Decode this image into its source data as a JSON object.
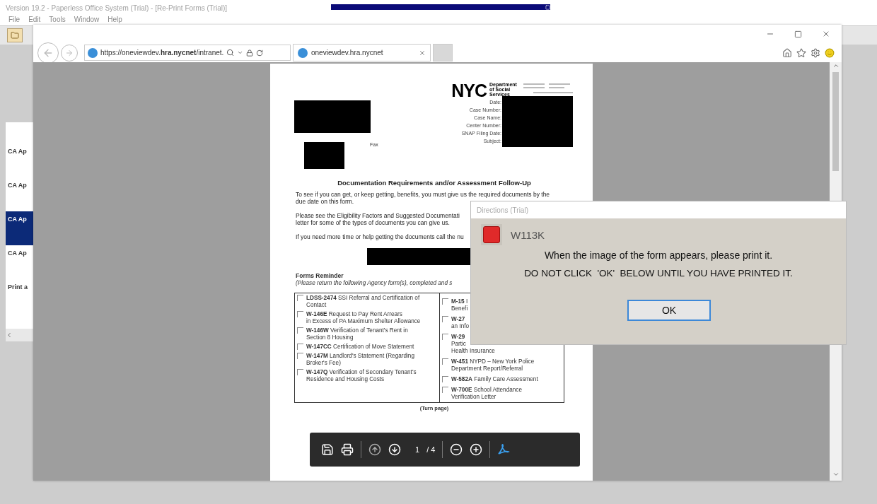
{
  "app": {
    "title": "Version 19.2 - Paperless Office System (Trial) - [Re-Print Forms (Trial)]",
    "menu": [
      "File",
      "Edit",
      "Tools",
      "Window",
      "Help"
    ]
  },
  "sidebar": {
    "items": [
      {
        "label": "CA Ap",
        "selected": false
      },
      {
        "label": "CA Ap",
        "selected": false
      },
      {
        "label": "CA Ap",
        "selected": true
      },
      {
        "label": "CA Ap",
        "selected": false
      },
      {
        "label": "Print a",
        "selected": false
      }
    ]
  },
  "browser": {
    "address": "https://oneviewdev.**hra.nycnet**/intranet.",
    "tabs": [
      {
        "label": "oneviewdev.hra.nycnet",
        "selected": true
      }
    ]
  },
  "document": {
    "logo": "NYC",
    "agency": "Department of Social Services",
    "fields": [
      "Date:",
      "Case Number:",
      "Case Name:",
      "Center Number:",
      "SNAP Filing Date:",
      "Subject:"
    ],
    "fax_label": "Fax",
    "heading": "Documentation Requirements and/or Assessment Follow-Up",
    "paragraphs": [
      {
        "lines": [
          "To see if you can get, or keep getting, benefits, you must give us the required documents by the",
          "due date on this form."
        ]
      },
      {
        "lines": [
          "Please see the Eligibility Factors and Suggested Documentati",
          "letter for some of the types of documents you can give us."
        ]
      },
      {
        "lines": [
          "If you need more time or help getting the documents call the nu"
        ]
      }
    ],
    "forms_title": "Forms Reminder",
    "forms_note": "(Please return the following Agency form(s), completed and s",
    "forms": [
      [
        {
          "lines": [
            "**LDSS-2474** SSI Referral and Certification of",
            "Contact"
          ],
          "checked": false
        },
        {
          "lines": [
            "**W-146E** Request to Pay Rent Arrears",
            "in Excess of PA Maximum Shelter Allowance"
          ],
          "checked": false
        },
        {
          "lines": [
            "**W-146W** Verification of Tenant's Rent in",
            "Section 8 Housing"
          ],
          "checked": false
        },
        {
          "lines": [
            "**W-147CC** Certification of Move Statement"
          ],
          "checked": false
        },
        {
          "lines": [
            "**W-147M** Landlord's Statement (Regarding",
            "Broker's Fee)"
          ],
          "checked": false
        },
        {
          "lines": [
            "**W-147Q** Verification of Secondary Tenant's",
            "Residence and Housing Costs"
          ],
          "checked": false
        }
      ],
      [
        {
          "lines": [
            "**M-15** I",
            "Benefi"
          ],
          "checked": false
        },
        {
          "lines": [
            "**W-27**",
            "an Info"
          ],
          "checked": false
        },
        {
          "lines": [
            "**W-29**",
            "Partic",
            "Health Insurance"
          ],
          "checked": false
        },
        {
          "lines": [
            "**W-451** NYPD – New York Police",
            "Department Report/Referral"
          ],
          "checked": false
        },
        {
          "lines": [
            "**W-582A** Family Care Assessment"
          ],
          "checked": false
        },
        {
          "lines": [
            "**W-700E** School Attendance",
            "Verification Letter"
          ],
          "checked": false
        }
      ]
    ],
    "footer": "(Turn page)"
  },
  "pdf_toolbar": {
    "page": "1",
    "total": "/ 4"
  },
  "dialog": {
    "title": "Directions (Trial)",
    "form_code": "W113K",
    "message": "When the image of the form appears, please print it.",
    "warning": "DO NOT CLICK  'OK'  BELOW UNTIL YOU HAVE PRINTED IT.",
    "button": "OK"
  }
}
